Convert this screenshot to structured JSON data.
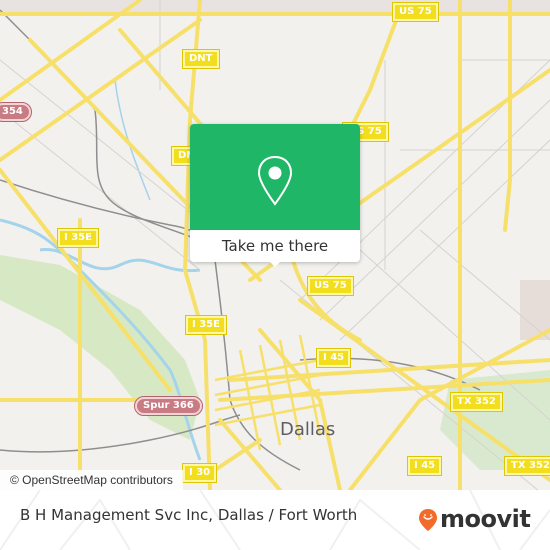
{
  "map": {
    "region": "Dallas / Fort Worth",
    "city_label": "Dallas",
    "attribution": "© OpenStreetMap contributors",
    "road_shields": [
      {
        "label": "US 75",
        "kind": "highway"
      },
      {
        "label": "DNT",
        "kind": "highway"
      },
      {
        "label": "354",
        "kind": "state-spur"
      },
      {
        "label": "US 75",
        "kind": "highway"
      },
      {
        "label": "DNT",
        "kind": "highway"
      },
      {
        "label": "I 35E",
        "kind": "highway"
      },
      {
        "label": "US 75",
        "kind": "highway"
      },
      {
        "label": "I 35E",
        "kind": "highway"
      },
      {
        "label": "I 45",
        "kind": "highway"
      },
      {
        "label": "Spur 366",
        "kind": "state-spur"
      },
      {
        "label": "TX 352",
        "kind": "highway"
      },
      {
        "label": "I 45",
        "kind": "highway"
      },
      {
        "label": "TX 352",
        "kind": "highway"
      },
      {
        "label": "I 30",
        "kind": "highway"
      }
    ]
  },
  "popup": {
    "icon": "map-pin-icon",
    "button_label": "Take me there"
  },
  "footer": {
    "place_title": "B H Management Svc Inc, Dallas / Fort Worth",
    "brand": "moovit",
    "brand_icon": "moovit-smile-pin-icon"
  },
  "colors": {
    "popup_green": "#1fb767",
    "brand_orange": "#f26b2a",
    "road_yellow": "#f7e06a",
    "map_bg": "#f2f1ee"
  }
}
